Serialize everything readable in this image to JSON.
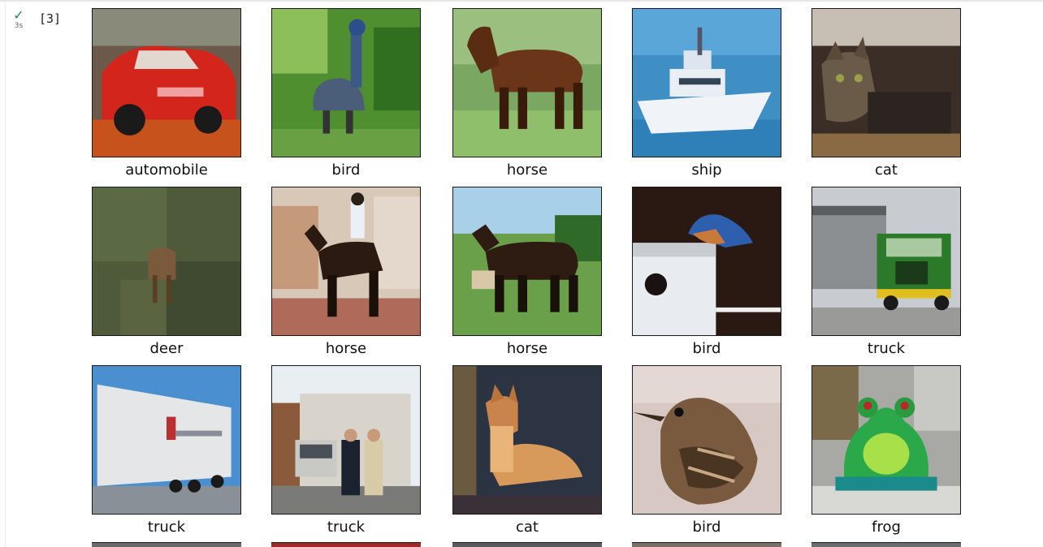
{
  "cell": {
    "exec_count": "[3]",
    "duration": "3s"
  },
  "images": [
    {
      "label": "automobile",
      "subject": "red car",
      "icon": "car-image"
    },
    {
      "label": "bird",
      "subject": "bird statue in greenery",
      "icon": "bird-image"
    },
    {
      "label": "horse",
      "subject": "brown horse on grass",
      "icon": "horse-image"
    },
    {
      "label": "ship",
      "subject": "white boat on water",
      "icon": "ship-image"
    },
    {
      "label": "cat",
      "subject": "dark tabby cat",
      "icon": "cat-image"
    },
    {
      "label": "deer",
      "subject": "deer in foliage",
      "icon": "deer-image"
    },
    {
      "label": "horse",
      "subject": "rider on dark horse",
      "icon": "horse-image"
    },
    {
      "label": "horse",
      "subject": "horse in field",
      "icon": "horse-image"
    },
    {
      "label": "bird",
      "subject": "bluebird on birdhouse",
      "icon": "bird-image"
    },
    {
      "label": "truck",
      "subject": "green semi truck",
      "icon": "truck-image"
    },
    {
      "label": "truck",
      "subject": "white trailer truck",
      "icon": "truck-image"
    },
    {
      "label": "truck",
      "subject": "truck with two people",
      "icon": "truck-image"
    },
    {
      "label": "cat",
      "subject": "ginger cat lying down",
      "icon": "cat-image"
    },
    {
      "label": "bird",
      "subject": "brown sparrow",
      "icon": "bird-image"
    },
    {
      "label": "frog",
      "subject": "green frog figurine",
      "icon": "frog-image"
    }
  ]
}
